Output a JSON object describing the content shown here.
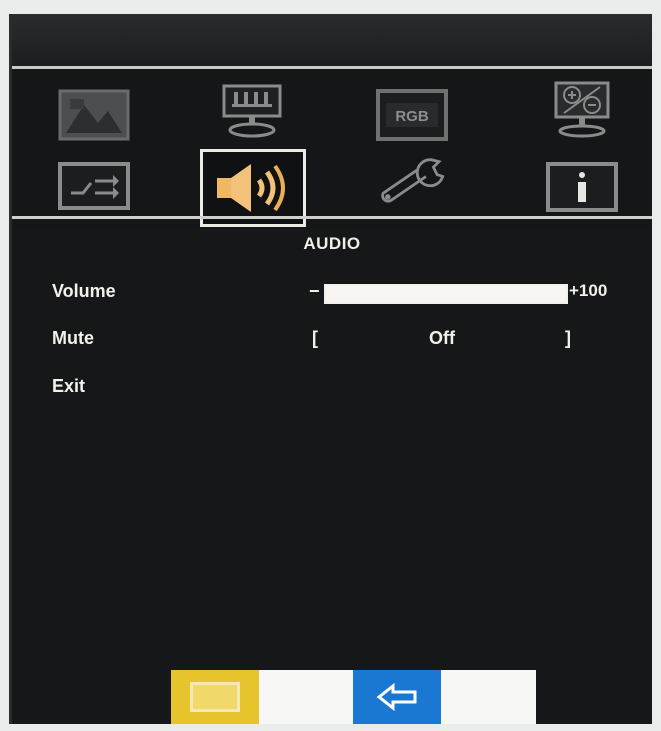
{
  "menu": {
    "icons": [
      {
        "name": "picture-icon",
        "selected": false
      },
      {
        "name": "display-icon",
        "selected": false
      },
      {
        "name": "rgb-icon",
        "text": "RGB",
        "selected": false
      },
      {
        "name": "color-adjust-icon",
        "selected": false
      },
      {
        "name": "input-switch-icon",
        "selected": false
      },
      {
        "name": "speaker-icon",
        "selected": true
      },
      {
        "name": "wrench-icon",
        "selected": false
      },
      {
        "name": "info-icon",
        "selected": false
      }
    ]
  },
  "panel": {
    "title": "AUDIO",
    "volume": {
      "label": "Volume",
      "minus": "−",
      "value_text": "+100",
      "level_percent": 100
    },
    "mute": {
      "label": "Mute",
      "bracket_left": "[",
      "bracket_right": "]",
      "value": "Off"
    },
    "exit": {
      "label": "Exit"
    }
  },
  "bottom": {
    "menu_button_icon": "menu-icon",
    "back_button_icon": "back-arrow-icon",
    "colors": {
      "menu": "#e6c42c",
      "back": "#1b78d2"
    }
  }
}
